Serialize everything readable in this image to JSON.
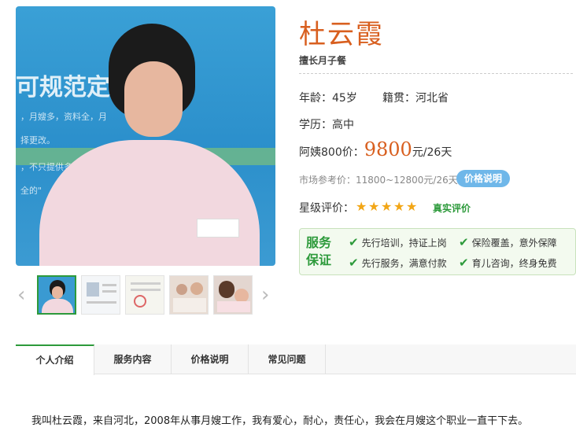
{
  "profile": {
    "name": "杜云霞",
    "specialty": "擅长月子餐",
    "age_label": "年龄：",
    "age_value": "45岁",
    "origin_label": "籍贯：",
    "origin_value": "河北省",
    "education_label": "学历：",
    "education_value": "高中",
    "price_label": "阿姨800价：",
    "price_value": "9800",
    "price_unit": "元/26天",
    "market_price": "市场参考价：11800~12800元/26天",
    "price_badge": "价格说明",
    "rating_label": "星级评价：",
    "rating_stars": 5,
    "rating_link": "真实评价"
  },
  "photo": {
    "wall_big": "可规范定",
    "wall_lines": [
      "，月嫂多，资料全，月",
      "择更改。",
      "，不只提供多",
      "全的\""
    ]
  },
  "service": {
    "title": "服务保证",
    "items": [
      "先行培训，持证上岗",
      "保险覆盖，意外保障",
      "先行服务，满意付款",
      "育儿咨询，终身免费"
    ]
  },
  "tabs": [
    "个人介绍",
    "服务内容",
    "价格说明",
    "常见问题"
  ],
  "intro": "我叫杜云霞，来自河北，2008年从事月嫂工作，我有爱心，耐心，责任心，我会在月嫂这个职业一直干下去。",
  "colors": {
    "accent": "#2d9a3b",
    "price": "#d85f1f",
    "badge": "#6fb7e9"
  }
}
